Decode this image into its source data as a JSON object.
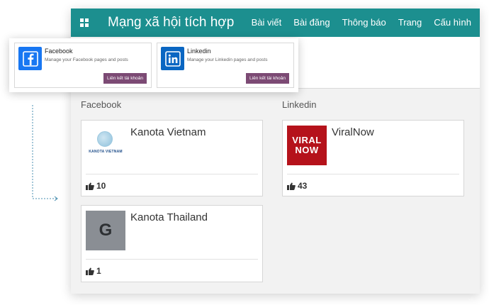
{
  "navbar": {
    "title": "Mạng xã hội tích hợp",
    "menu": [
      "Bài viết",
      "Bài đăng",
      "Thông báo",
      "Trang",
      "Cấu hình"
    ]
  },
  "popup": {
    "facebook": {
      "name": "Facebook",
      "description": "Manage your Facebook pages and posts",
      "button": "Liên kết tài khoản"
    },
    "linkedin": {
      "name": "Linkedin",
      "description": "Manage your Linkedin pages and posts",
      "button": "Liên kết tài khoản"
    }
  },
  "columns": {
    "facebook": {
      "title": "Facebook",
      "accounts": [
        {
          "name": "Kanota Vietnam",
          "likes": "10",
          "logo_text": "KANOTA VIETNAM"
        },
        {
          "name": "Kanota Thailand",
          "likes": "1",
          "logo_letter": "G"
        }
      ]
    },
    "linkedin": {
      "title": "Linkedin",
      "accounts": [
        {
          "name": "ViralNow",
          "likes": "43",
          "logo_text": [
            "VIRAL",
            "NOW"
          ]
        }
      ]
    }
  },
  "colors": {
    "navbar": "#1c8f8f",
    "link_button": "#7c4a74",
    "facebook_brand": "#1877f2",
    "linkedin_brand": "#0a66c2",
    "viral_red": "#b5121b"
  }
}
